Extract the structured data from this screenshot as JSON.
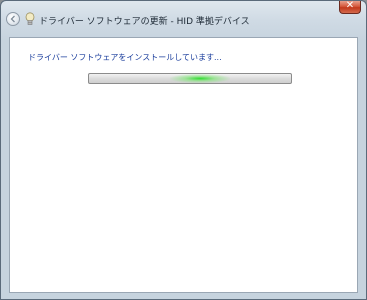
{
  "window": {
    "title": "ドライバー ソフトウェアの更新 - HID 準拠デバイス",
    "close_glyph": "✕"
  },
  "icons": {
    "back": "back-arrow-icon",
    "device": "device-icon"
  },
  "content": {
    "status": "ドライバー ソフトウェアをインストールしています...",
    "progress_marquee_position": 0.45
  },
  "colors": {
    "status_text": "#1a3d9c",
    "progress_glow": "#28dc28",
    "close_button": "#c2391c"
  }
}
